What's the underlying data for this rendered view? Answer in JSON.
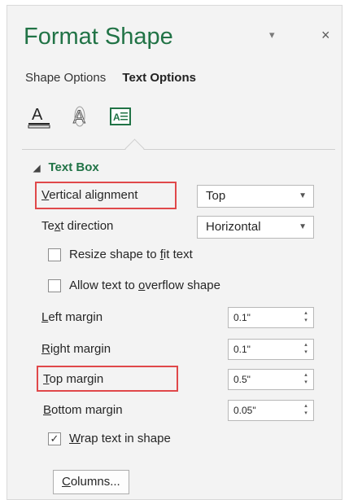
{
  "pane": {
    "title": "Format Shape",
    "pin_glyph": "▾",
    "close_glyph": "×"
  },
  "tabs": [
    {
      "label": "Shape Options",
      "active": false
    },
    {
      "label": "Text Options",
      "active": true
    }
  ],
  "icon_tabs": [
    "text-fill-outline-icon",
    "text-effects-icon",
    "textbox-icon"
  ],
  "section": {
    "title": "Text Box",
    "vertical_alignment": {
      "pre": "",
      "ul": "V",
      "post": "ertical alignment",
      "value": "Top"
    },
    "text_direction": {
      "pre": "Te",
      "ul": "x",
      "post": "t direction",
      "value": "Horizontal"
    },
    "resize": {
      "pre": "Resize shape to ",
      "ul": "f",
      "post": "it text",
      "checked": false
    },
    "overflow": {
      "pre": "Allow text to ",
      "ul": "o",
      "post": "verflow shape",
      "checked": false
    },
    "left_margin": {
      "pre": "",
      "ul": "L",
      "post": "eft margin",
      "value": "0.1\""
    },
    "right_margin": {
      "pre": "",
      "ul": "R",
      "post": "ight margin",
      "value": "0.1\""
    },
    "top_margin": {
      "pre": "",
      "ul": "T",
      "post": "op margin",
      "value": "0.5\""
    },
    "bottom_margin": {
      "pre": "",
      "ul": "B",
      "post": "ottom margin",
      "value": "0.05\""
    },
    "wrap": {
      "pre": "",
      "ul": "W",
      "post": "rap text in shape",
      "checked": true
    },
    "columns": {
      "pre": "",
      "ul": "C",
      "post": "olumns..."
    }
  },
  "colors": {
    "title": "#217346",
    "highlight": "#e0484a",
    "pane_bg": "#f3f3f3"
  }
}
